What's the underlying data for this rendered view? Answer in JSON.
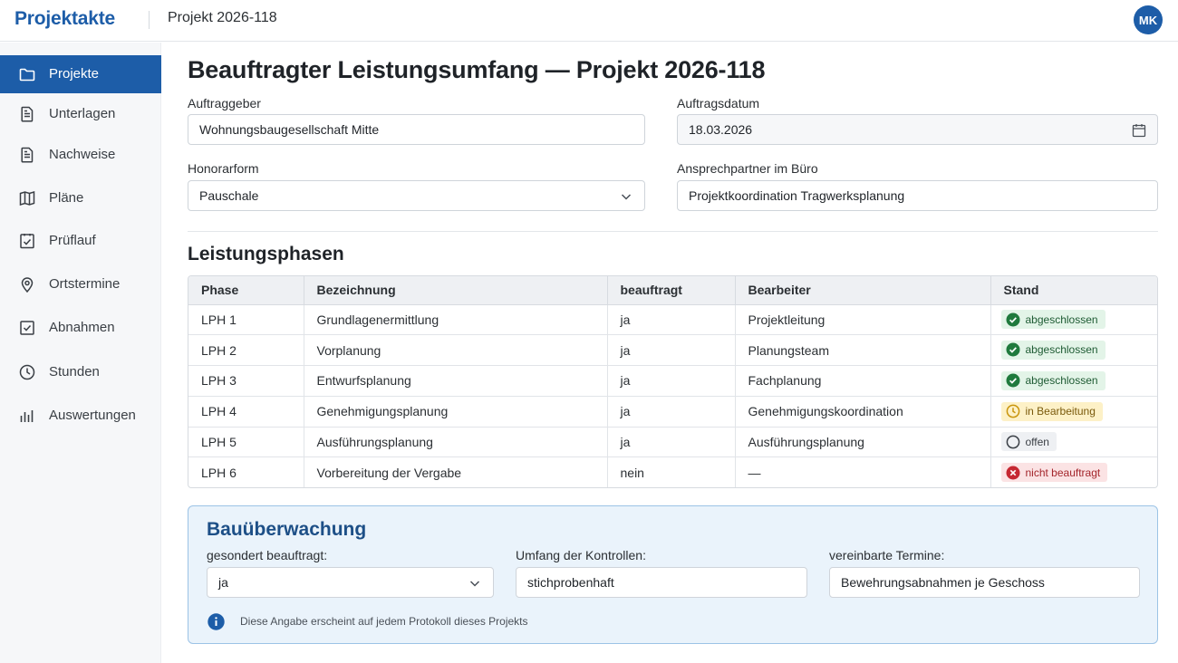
{
  "header": {
    "brand": "Projektakte",
    "project": "Projekt 2026-118",
    "user_initials": "MK",
    "accent_color": "#1d5da8"
  },
  "sidebar": {
    "items": [
      {
        "label": "Projekte",
        "icon": "folder-icon",
        "active": true
      },
      {
        "label": "Unterlagen",
        "icon": "document-icon",
        "active": false
      },
      {
        "label": "Nachweise",
        "icon": "document-icon",
        "active": false
      },
      {
        "label": "Pläne",
        "icon": "map-icon",
        "active": false
      },
      {
        "label": "Prüflauf",
        "icon": "checklist-icon",
        "active": false
      },
      {
        "label": "Ortstermine",
        "icon": "location-pin-icon",
        "active": false
      },
      {
        "label": "Abnahmen",
        "icon": "checkbox-icon",
        "active": false
      },
      {
        "label": "Stunden",
        "icon": "clock-icon",
        "active": false
      },
      {
        "label": "Auswertungen",
        "icon": "bar-chart-icon",
        "active": false
      }
    ]
  },
  "main": {
    "title": "Beauftragter Leistungsumfang — Projekt 2026-118",
    "fields": {
      "auftraggeber": {
        "label": "Auftraggeber",
        "value": "Wohnungsbaugesellschaft Mitte"
      },
      "auftragsdatum": {
        "label": "Auftragsdatum",
        "value": "18.03.2026"
      },
      "honorarform": {
        "label": "Honorarform",
        "value": "Pauschale"
      },
      "ansprechpartner": {
        "label": "Ansprechpartner im Büro",
        "value": "Projektkoordination Tragwerksplanung"
      }
    },
    "phases": {
      "title": "Leistungsphasen",
      "columns": [
        "Phase",
        "Bezeichnung",
        "beauftragt",
        "Bearbeiter",
        "Stand"
      ],
      "rows": [
        {
          "phase": "LPH 1",
          "bezeichnung": "Grundlagenermittlung",
          "beauftragt": "ja",
          "bearbeiter": "Projektleitung",
          "stand": "abgeschlossen",
          "status": "done"
        },
        {
          "phase": "LPH 2",
          "bezeichnung": "Vorplanung",
          "beauftragt": "ja",
          "bearbeiter": "Planungsteam",
          "stand": "abgeschlossen",
          "status": "done"
        },
        {
          "phase": "LPH 3",
          "bezeichnung": "Entwurfsplanung",
          "beauftragt": "ja",
          "bearbeiter": "Fachplanung",
          "stand": "abgeschlossen",
          "status": "done"
        },
        {
          "phase": "LPH 4",
          "bezeichnung": "Genehmigungsplanung",
          "beauftragt": "ja",
          "bearbeiter": "Genehmigungskoordination",
          "stand": "in Bearbeitung",
          "status": "progress"
        },
        {
          "phase": "LPH 5",
          "bezeichnung": "Ausführungsplanung",
          "beauftragt": "ja",
          "bearbeiter": "Ausführungsplanung",
          "stand": "offen",
          "status": "open"
        },
        {
          "phase": "LPH 6",
          "bezeichnung": "Vorbereitung der Vergabe",
          "beauftragt": "nein",
          "bearbeiter": "—",
          "stand": "nicht beauftragt",
          "status": "no"
        }
      ]
    },
    "bauueberwachung": {
      "title": "Bauüberwachung",
      "gesondert": {
        "label": "gesondert beauftragt:",
        "value": "ja"
      },
      "umfang": {
        "label": "Umfang der Kontrollen:",
        "value": "stichprobenhaft"
      },
      "termine": {
        "label": "vereinbarte Termine:",
        "value": "Bewehrungsabnahmen je Geschoss"
      },
      "info": "Diese Angabe erscheint auf jedem Protokoll dieses Projekts"
    }
  }
}
